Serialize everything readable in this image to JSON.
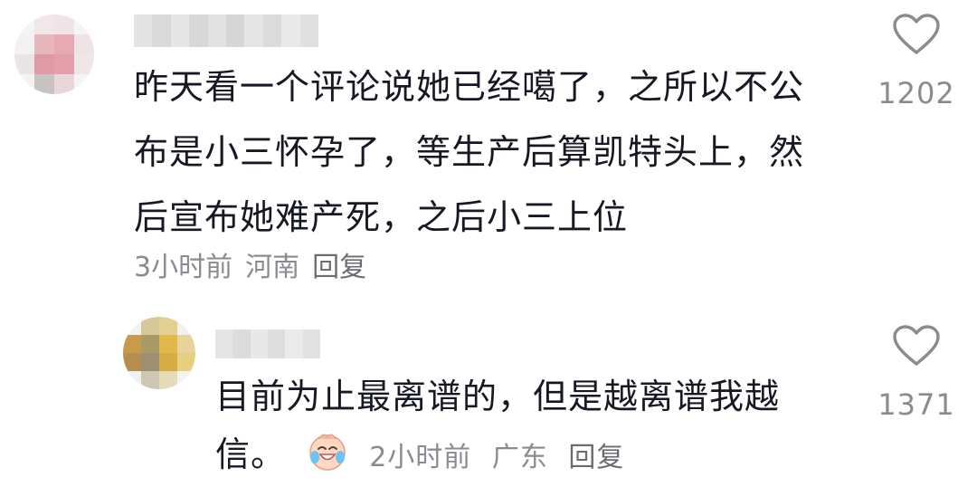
{
  "comments": [
    {
      "username": "",
      "avatar": "blurred-pink-avatar",
      "lines": [
        "昨天看一个评论说她已经噶了，之所以不公",
        "布是小三怀孕了，等生产后算凯特头上，然",
        "后宣布她难产死，之后小三上位"
      ],
      "time": "3小时前",
      "location": "河南",
      "reply_label": "回复",
      "like_count": "1202"
    },
    {
      "username": "",
      "avatar": "blurred-yellow-avatar",
      "lines": [
        "目前为止最离谱的，但是越离谱我越",
        "信。"
      ],
      "emoji": "crying-laughing-emoji",
      "time": "2小时前",
      "location": "广东",
      "reply_label": "回复",
      "like_count": "1371"
    }
  ],
  "colors": {
    "text": "#161823",
    "meta": "#8a8b91",
    "icon_stroke": "#8a8b91"
  }
}
